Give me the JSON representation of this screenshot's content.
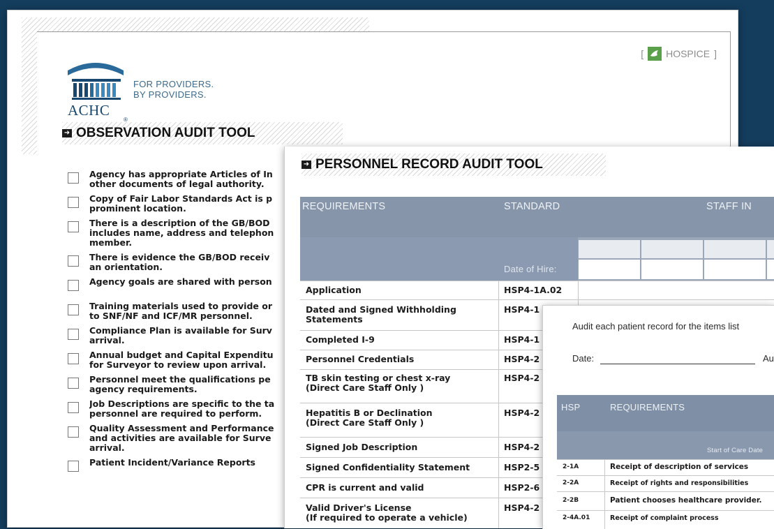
{
  "observation_sheet": {
    "logo": {
      "brand": "ACHC",
      "registered": "®",
      "tagline": [
        "FOR PROVIDERS.",
        "BY PROVIDERS."
      ]
    },
    "service_tag": {
      "open_bracket": "[",
      "label": "HOSPICE",
      "close_bracket": "]",
      "icon": "dove-icon"
    },
    "title": "OBSERVATION AUDIT TOOL",
    "items": [
      "Agency has appropriate Articles of In\nother documents of legal authority.",
      "Copy of Fair Labor Standards Act is p\nprominent location.",
      "There is a description of the GB/BOD\nincludes name, address and telephon\nmember.",
      "There is evidence the GB/BOD receiv\nan orientation.",
      "Agency goals are shared with person",
      "Training materials used to provide or\nto SNF/NF and ICF/MR personnel.",
      "Compliance Plan is available for Surv\narrival.",
      "Annual budget and Capital Expenditu\nfor Surveyor to review upon arrival.",
      "Personnel meet the qualifications pe\nagency requirements.",
      "Job Descriptions are specific to the ta\npersonnel are required to perform.",
      "Quality Assessment and Performance\nand activities are available for Surve\narrival.",
      "Patient Incident/Variance Reports"
    ]
  },
  "personnel_sheet": {
    "title": "PERSONNEL RECORD AUDIT TOOL",
    "headers": {
      "requirements": "REQUIREMENTS",
      "standard": "STANDARD",
      "staff": "STAFF IN",
      "date_of_hire": "Date of Hire:"
    },
    "rows": [
      {
        "req": "Application",
        "std": "HSP4-1A.02"
      },
      {
        "req": "Dated and Signed Withholding\nStatements",
        "std": "HSP4-1"
      },
      {
        "req": "Completed I-9",
        "std": "HSP4-1"
      },
      {
        "req": "Personnel Credentials",
        "std": "HSP4-2"
      },
      {
        "req": "TB skin testing or chest x-ray\n(Direct Care Staff Only )",
        "std": "HSP4-2"
      },
      {
        "req": "Hepatitis B or Declination\n(Direct Care Staff Only )",
        "std": "HSP4-2"
      },
      {
        "req": "Signed Job Description",
        "std": "HSP4-2"
      },
      {
        "req": "Signed Confidentiality Statement",
        "std": "HSP2-5"
      },
      {
        "req": "CPR is current and valid",
        "std": "HSP2-6"
      },
      {
        "req": "Valid Driver's License\n(If required to operate a vehicle)",
        "std": "HSP4-2"
      }
    ]
  },
  "patient_sheet": {
    "intro": "Audit each patient record for the items list",
    "date_label": "Date:",
    "auditor_label": "Au",
    "headers": {
      "hsp": "HSP",
      "requirements": "REQUIREMENTS",
      "start_of_care": "Start of Care Date"
    },
    "rows": [
      {
        "code": "2-1A",
        "desc": "Receipt of description of services"
      },
      {
        "code": "2-2A",
        "desc": "Receipt of rights and responsibilities"
      },
      {
        "code": "2-2B",
        "desc": "Patient chooses healthcare provider."
      },
      {
        "code": "2-4A.01",
        "desc": "Receipt of complaint process"
      }
    ]
  },
  "colors": {
    "background": "#143c5c",
    "table_header": "#8695aa",
    "brand_blue": "#184770",
    "hospice_green": "#5aa04a"
  }
}
